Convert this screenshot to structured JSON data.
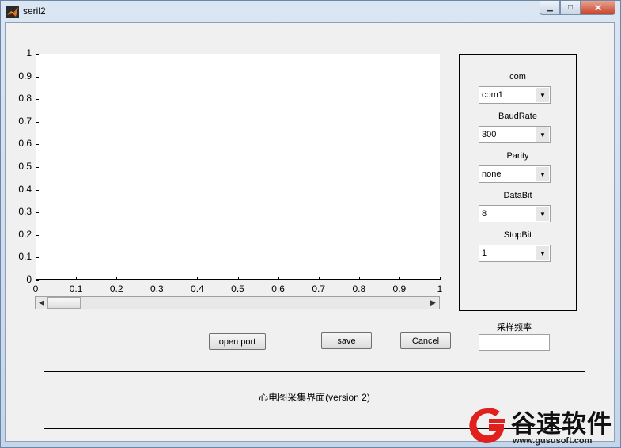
{
  "window": {
    "title": "seril2",
    "minimize_label": "▁",
    "maximize_label": "□",
    "close_label": "✕"
  },
  "axes": {
    "yticks": [
      "0",
      "0.1",
      "0.2",
      "0.3",
      "0.4",
      "0.5",
      "0.6",
      "0.7",
      "0.8",
      "0.9",
      "1"
    ],
    "xticks": [
      "0",
      "0.1",
      "0.2",
      "0.3",
      "0.4",
      "0.5",
      "0.6",
      "0.7",
      "0.8",
      "0.9",
      "1"
    ]
  },
  "chart_data": {
    "type": "line",
    "series": [],
    "xlim": [
      0,
      1
    ],
    "ylim": [
      0,
      1
    ],
    "grid": false
  },
  "scrollbar": {
    "left_arrow": "◀",
    "right_arrow": "▶",
    "value_fraction": 0
  },
  "settings": {
    "com": {
      "label": "com",
      "value": "com1"
    },
    "baud": {
      "label": "BaudRate",
      "value": "300"
    },
    "parity": {
      "label": "Parity",
      "value": "none"
    },
    "databit": {
      "label": "DataBit",
      "value": "8"
    },
    "stopbit": {
      "label": "StopBit",
      "value": "1"
    },
    "dropdown_arrow": "▼"
  },
  "buttons": {
    "open_port": "open port",
    "save": "save",
    "cancel": "Cancel"
  },
  "sampling": {
    "label": "采样频率",
    "value": ""
  },
  "footer": {
    "text": "心电图采集界面(version   2)"
  },
  "watermark": {
    "name": "谷速软件",
    "url": "www.gususoft.com",
    "brand_color": "#e0201c"
  }
}
